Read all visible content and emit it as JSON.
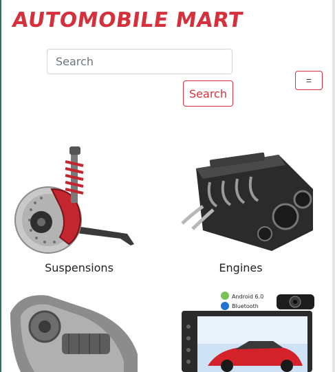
{
  "brand": {
    "name": "AUTOMOBILE MART"
  },
  "search": {
    "placeholder": "Search",
    "button_label": "Search"
  },
  "menu": {
    "toggle_label": "="
  },
  "categories": [
    {
      "label": "Suspensions"
    },
    {
      "label": "Engines"
    },
    {
      "label": ""
    },
    {
      "label": ""
    }
  ],
  "stereo_badges": [
    "Android 6.0",
    "Bluetooth"
  ],
  "colors": {
    "brand_red": "#d6303c",
    "text_dark": "#222222",
    "border_gray": "#ced4da"
  }
}
